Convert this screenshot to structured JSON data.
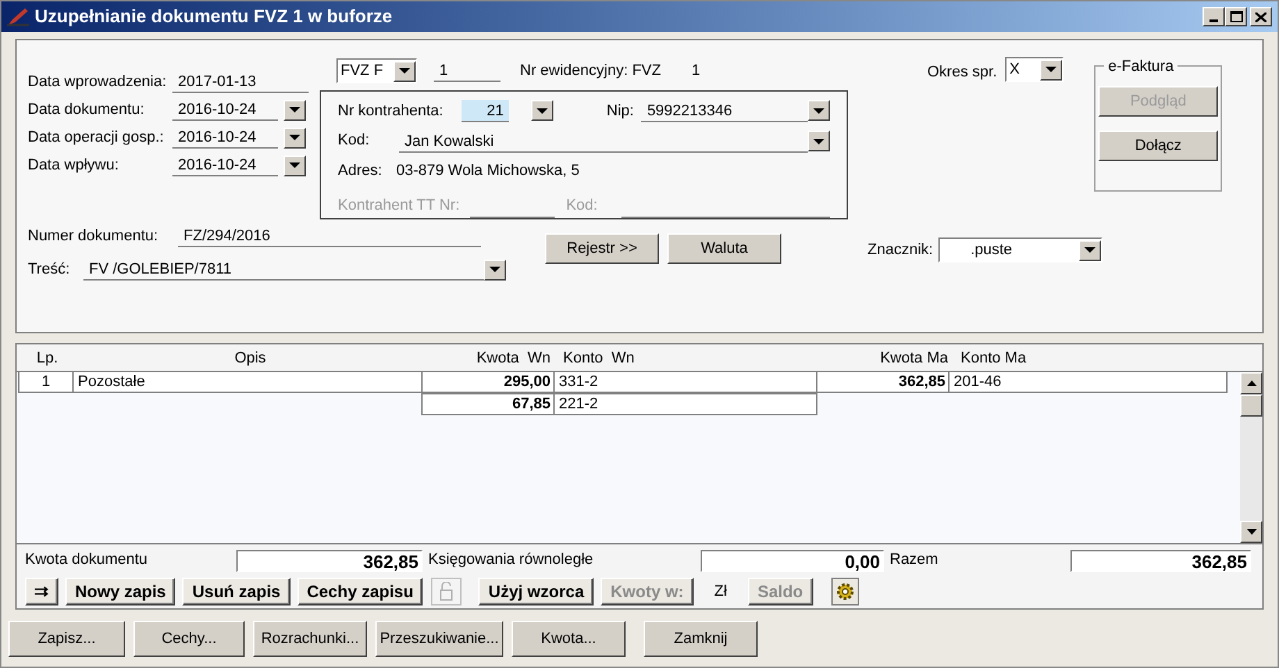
{
  "window": {
    "title": "Uzupełnianie dokumentu FVZ 1 w buforze"
  },
  "dates": [
    {
      "label": "Data wprowadzenia:",
      "value": "2017-01-13",
      "kind": "text"
    },
    {
      "label": "Data dokumentu:",
      "value": "2016-10-24",
      "kind": "dropdown"
    },
    {
      "label": "Data operacji gosp.:",
      "value": "2016-10-24",
      "kind": "dropdown"
    },
    {
      "label": "Data wpływu:",
      "value": "2016-10-24",
      "kind": "dropdown"
    }
  ],
  "register": {
    "type": "FVZ F",
    "number": "1",
    "label": "Nr ewidencyjny: FVZ",
    "value": "1"
  },
  "contractor": {
    "nr_label": "Nr kontrahenta:",
    "nr": "21",
    "nr_focused": true,
    "nip_label": "Nip:",
    "nip": "5992213346",
    "kod_label": "Kod:",
    "kod": "Jan Kowalski",
    "adres_label": "Adres:",
    "adres": "03-879 Wola Michowska, 5",
    "tt_label": "Kontrahent TT Nr:",
    "tt_kod_label": "Kod:"
  },
  "period": {
    "label": "Okres spr.",
    "value": "X"
  },
  "efaktura": {
    "title": "e-Faktura",
    "buttons": [
      {
        "label": "Podgląd",
        "disabled": true
      },
      {
        "label": "Dołącz",
        "disabled": false
      }
    ]
  },
  "doc_number": {
    "label": "Numer dokumentu:",
    "value": "FZ/294/2016"
  },
  "content": {
    "label": "Treść:",
    "value": "FV /GOLEBIEP/7811"
  },
  "mid_buttons": [
    "Rejestr >>",
    "Waluta"
  ],
  "marker": {
    "label": "Znacznik:",
    "value": ".puste"
  },
  "table": {
    "columns": [
      "Lp.",
      "Opis",
      "Kwota  Wn",
      "Konto  Wn",
      "Kwota Ma",
      "Konto Ma"
    ],
    "rows": [
      {
        "lp": "1",
        "opis": "Pozostałe",
        "kwota_wn": "295,00",
        "konto_wn": "331-2",
        "kwota_ma": "362,85",
        "konto_ma": "201-46"
      },
      {
        "kwota_wn": "67,85",
        "konto_wn": "221-2"
      }
    ]
  },
  "totals": [
    {
      "label": "Kwota dokumentu",
      "value": "362,85"
    },
    {
      "label": "Księgowania równoległe",
      "value": "0,00"
    },
    {
      "label": "Razem",
      "value": "362,85"
    }
  ],
  "toolbar": [
    {
      "kind": "swap"
    },
    {
      "kind": "button",
      "label": "Nowy zapis",
      "disabled": false
    },
    {
      "kind": "button",
      "label": "Usuń zapis",
      "disabled": false
    },
    {
      "kind": "button",
      "label": "Cechy zapisu",
      "disabled": false
    },
    {
      "kind": "lock",
      "disabled": true
    },
    {
      "kind": "button",
      "label": "Użyj wzorca",
      "disabled": false
    },
    {
      "kind": "button",
      "label": "Kwoty w:",
      "disabled": true
    },
    {
      "kind": "text",
      "label": "Zł"
    },
    {
      "kind": "button",
      "label": "Saldo",
      "disabled": true
    },
    {
      "kind": "gear"
    }
  ],
  "footer_buttons": [
    "Zapisz...",
    "Cechy...",
    "Rozrachunki...",
    "Przeszukiwanie...",
    "Kwota...",
    "Zamknij"
  ]
}
